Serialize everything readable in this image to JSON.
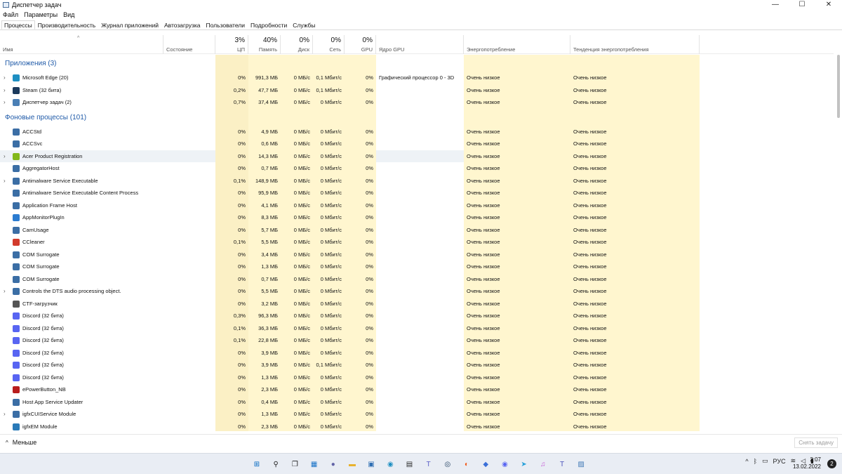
{
  "window": {
    "title": "Диспетчер задач",
    "controls": {
      "minimize": "—",
      "maximize": "☐",
      "close": "✕"
    }
  },
  "menu": [
    "Файл",
    "Параметры",
    "Вид"
  ],
  "tabs": [
    "Процессы",
    "Производительность",
    "Журнал приложений",
    "Автозагрузка",
    "Пользователи",
    "Подробности",
    "Службы"
  ],
  "active_tab": "Процессы",
  "columns": {
    "name": "Имя",
    "status": "Состояние",
    "cpu": {
      "pct": "3%",
      "label": "ЦП"
    },
    "memory": {
      "pct": "40%",
      "label": "Память"
    },
    "disk": {
      "pct": "0%",
      "label": "Диск"
    },
    "network": {
      "pct": "0%",
      "label": "Сеть"
    },
    "gpu": {
      "pct": "0%",
      "label": "GPU"
    },
    "gpu_engine": "Ядро GPU",
    "power": "Энергопотребление",
    "power_trend": "Тенденция энергопотребления"
  },
  "groups": {
    "apps": "Приложения (3)",
    "background": "Фоновые процессы (101)"
  },
  "apps": [
    {
      "name": "Microsoft Edge (20)",
      "expand": true,
      "icon": "edge-icon",
      "color": "#1e8fc2",
      "cpu": "0%",
      "mem": "991,3 МБ",
      "disk": "0 МБ/с",
      "net": "0,1 Мбит/с",
      "gpu": "0%",
      "engine": "Графический процессор 0 - 3D",
      "power": "Очень низкое",
      "trend": "Очень низкое"
    },
    {
      "name": "Steam (32 бита)",
      "expand": true,
      "icon": "steam-icon",
      "color": "#1b3a5c",
      "cpu": "0,2%",
      "mem": "47,7 МБ",
      "disk": "0 МБ/с",
      "net": "0,1 Мбит/с",
      "gpu": "0%",
      "engine": "",
      "power": "Очень низкое",
      "trend": "Очень низкое"
    },
    {
      "name": "Диспетчер задач (2)",
      "expand": true,
      "icon": "task-manager-icon",
      "color": "#4a7fb5",
      "cpu": "0,7%",
      "mem": "37,4 МБ",
      "disk": "0 МБ/с",
      "net": "0 Мбит/с",
      "gpu": "0%",
      "engine": "",
      "power": "Очень низкое",
      "trend": "Очень низкое"
    }
  ],
  "background": [
    {
      "name": "ACCStd",
      "expand": false,
      "icon": "window-icon",
      "color": "#3b6ea5",
      "cpu": "0%",
      "mem": "4,9 МБ",
      "disk": "0 МБ/с",
      "net": "0 Мбит/с",
      "gpu": "0%",
      "power": "Очень низкое",
      "trend": "Очень низкое"
    },
    {
      "name": "ACCSvc",
      "expand": false,
      "icon": "window-icon",
      "color": "#3b6ea5",
      "cpu": "0%",
      "mem": "0,6 МБ",
      "disk": "0 МБ/с",
      "net": "0 Мбит/с",
      "gpu": "0%",
      "power": "Очень низкое",
      "trend": "Очень низкое"
    },
    {
      "name": "Acer Product Registration",
      "expand": true,
      "icon": "acer-icon",
      "color": "#83b81a",
      "cpu": "0%",
      "mem": "14,3 МБ",
      "disk": "0 МБ/с",
      "net": "0 Мбит/с",
      "gpu": "0%",
      "power": "Очень низкое",
      "trend": "Очень низкое",
      "selected": true
    },
    {
      "name": "AggregatorHost",
      "expand": false,
      "icon": "window-icon",
      "color": "#3b6ea5",
      "cpu": "0%",
      "mem": "0,7 МБ",
      "disk": "0 МБ/с",
      "net": "0 Мбит/с",
      "gpu": "0%",
      "power": "Очень низкое",
      "trend": "Очень низкое"
    },
    {
      "name": "Antimalware Service Executable",
      "expand": true,
      "icon": "window-icon",
      "color": "#3b6ea5",
      "cpu": "0,1%",
      "mem": "148,9 МБ",
      "disk": "0 МБ/с",
      "net": "0 Мбит/с",
      "gpu": "0%",
      "power": "Очень низкое",
      "trend": "Очень низкое"
    },
    {
      "name": "Antimalware Service Executable Content Process",
      "expand": false,
      "icon": "window-icon",
      "color": "#3b6ea5",
      "cpu": "0%",
      "mem": "95,9 МБ",
      "disk": "0 МБ/с",
      "net": "0 Мбит/с",
      "gpu": "0%",
      "power": "Очень низкое",
      "trend": "Очень низкое"
    },
    {
      "name": "Application Frame Host",
      "expand": false,
      "icon": "window-icon",
      "color": "#3b6ea5",
      "cpu": "0%",
      "mem": "4,1 МБ",
      "disk": "0 МБ/с",
      "net": "0 Мбит/с",
      "gpu": "0%",
      "power": "Очень низкое",
      "trend": "Очень низкое"
    },
    {
      "name": "AppMonitorPlugIn",
      "expand": false,
      "icon": "app-monitor-icon",
      "color": "#2b7bd0",
      "cpu": "0%",
      "mem": "8,3 МБ",
      "disk": "0 МБ/с",
      "net": "0 Мбит/с",
      "gpu": "0%",
      "power": "Очень низкое",
      "trend": "Очень низкое"
    },
    {
      "name": "CamUsage",
      "expand": false,
      "icon": "window-icon",
      "color": "#3b6ea5",
      "cpu": "0%",
      "mem": "5,7 МБ",
      "disk": "0 МБ/с",
      "net": "0 Мбит/с",
      "gpu": "0%",
      "power": "Очень низкое",
      "trend": "Очень низкое"
    },
    {
      "name": "CCleaner",
      "expand": false,
      "icon": "ccleaner-icon",
      "color": "#d23b2c",
      "cpu": "0,1%",
      "mem": "5,5 МБ",
      "disk": "0 МБ/с",
      "net": "0 Мбит/с",
      "gpu": "0%",
      "power": "Очень низкое",
      "trend": "Очень низкое"
    },
    {
      "name": "COM Surrogate",
      "expand": false,
      "icon": "window-icon",
      "color": "#3b6ea5",
      "cpu": "0%",
      "mem": "3,4 МБ",
      "disk": "0 МБ/с",
      "net": "0 Мбит/с",
      "gpu": "0%",
      "power": "Очень низкое",
      "trend": "Очень низкое"
    },
    {
      "name": "COM Surrogate",
      "expand": false,
      "icon": "window-icon",
      "color": "#3b6ea5",
      "cpu": "0%",
      "mem": "1,3 МБ",
      "disk": "0 МБ/с",
      "net": "0 Мбит/с",
      "gpu": "0%",
      "power": "Очень низкое",
      "trend": "Очень низкое"
    },
    {
      "name": "COM Surrogate",
      "expand": false,
      "icon": "window-icon",
      "color": "#3b6ea5",
      "cpu": "0%",
      "mem": "0,7 МБ",
      "disk": "0 МБ/с",
      "net": "0 Мбит/с",
      "gpu": "0%",
      "power": "Очень низкое",
      "trend": "Очень низкое"
    },
    {
      "name": "Controls the DTS audio processing object.",
      "expand": true,
      "icon": "window-icon",
      "color": "#3b6ea5",
      "cpu": "0%",
      "mem": "5,5 МБ",
      "disk": "0 МБ/с",
      "net": "0 Мбит/с",
      "gpu": "0%",
      "power": "Очень низкое",
      "trend": "Очень низкое"
    },
    {
      "name": "CTF-загрузчик",
      "expand": false,
      "icon": "ctf-loader-icon",
      "color": "#555555",
      "cpu": "0%",
      "mem": "3,2 МБ",
      "disk": "0 МБ/с",
      "net": "0 Мбит/с",
      "gpu": "0%",
      "power": "Очень низкое",
      "trend": "Очень низкое"
    },
    {
      "name": "Discord (32 бита)",
      "expand": false,
      "icon": "discord-icon",
      "color": "#5865f2",
      "cpu": "0,3%",
      "mem": "96,3 МБ",
      "disk": "0 МБ/с",
      "net": "0 Мбит/с",
      "gpu": "0%",
      "power": "Очень низкое",
      "trend": "Очень низкое"
    },
    {
      "name": "Discord (32 бита)",
      "expand": false,
      "icon": "discord-icon",
      "color": "#5865f2",
      "cpu": "0,1%",
      "mem": "36,3 МБ",
      "disk": "0 МБ/с",
      "net": "0 Мбит/с",
      "gpu": "0%",
      "power": "Очень низкое",
      "trend": "Очень низкое"
    },
    {
      "name": "Discord (32 бита)",
      "expand": false,
      "icon": "discord-paused-icon",
      "color": "#5865f2",
      "cpu": "0,1%",
      "mem": "22,8 МБ",
      "disk": "0 МБ/с",
      "net": "0 Мбит/с",
      "gpu": "0%",
      "power": "Очень низкое",
      "trend": "Очень низкое"
    },
    {
      "name": "Discord (32 бита)",
      "expand": false,
      "icon": "discord-icon",
      "color": "#5865f2",
      "cpu": "0%",
      "mem": "3,9 МБ",
      "disk": "0 МБ/с",
      "net": "0 Мбит/с",
      "gpu": "0%",
      "power": "Очень низкое",
      "trend": "Очень низкое"
    },
    {
      "name": "Discord (32 бита)",
      "expand": false,
      "icon": "discord-icon",
      "color": "#5865f2",
      "cpu": "0%",
      "mem": "3,9 МБ",
      "disk": "0 МБ/с",
      "net": "0,1 Мбит/с",
      "gpu": "0%",
      "power": "Очень низкое",
      "trend": "Очень низкое"
    },
    {
      "name": "Discord (32 бита)",
      "expand": false,
      "icon": "discord-icon",
      "color": "#5865f2",
      "cpu": "0%",
      "mem": "1,3 МБ",
      "disk": "0 МБ/с",
      "net": "0 Мбит/с",
      "gpu": "0%",
      "power": "Очень низкое",
      "trend": "Очень низкое"
    },
    {
      "name": "ePowerButton_NB",
      "expand": false,
      "icon": "power-button-icon",
      "color": "#b81d1d",
      "cpu": "0%",
      "mem": "2,3 МБ",
      "disk": "0 МБ/с",
      "net": "0 Мбит/с",
      "gpu": "0%",
      "power": "Очень низкое",
      "trend": "Очень низкое"
    },
    {
      "name": "Host App Service Updater",
      "expand": false,
      "icon": "window-icon",
      "color": "#3b6ea5",
      "cpu": "0%",
      "mem": "0,4 МБ",
      "disk": "0 МБ/с",
      "net": "0 Мбит/с",
      "gpu": "0%",
      "power": "Очень низкое",
      "trend": "Очень низкое"
    },
    {
      "name": "igfxCUIService Module",
      "expand": true,
      "icon": "window-icon",
      "color": "#3b6ea5",
      "cpu": "0%",
      "mem": "1,3 МБ",
      "disk": "0 МБ/с",
      "net": "0 Мбит/с",
      "gpu": "0%",
      "power": "Очень низкое",
      "trend": "Очень низкое"
    },
    {
      "name": "igfxEM Module",
      "expand": false,
      "icon": "igfx-icon",
      "color": "#2a7ab8",
      "cpu": "0%",
      "mem": "2,3 МБ",
      "disk": "0 МБ/с",
      "net": "0 Мбит/с",
      "gpu": "0%",
      "power": "Очень низкое",
      "trend": "Очень низкое"
    }
  ],
  "footer": {
    "fewer_details": "Меньше",
    "end_task": "Снять задачу"
  },
  "taskbar": {
    "icons": [
      {
        "name": "start-icon",
        "glyph": "⊞",
        "color": "#0067c0"
      },
      {
        "name": "search-icon",
        "glyph": "⚲",
        "color": "#222222"
      },
      {
        "name": "task-view-icon",
        "glyph": "❐",
        "color": "#222222"
      },
      {
        "name": "widgets-icon",
        "glyph": "▦",
        "color": "#1a73c7"
      },
      {
        "name": "chat-icon",
        "glyph": "●",
        "color": "#6264a7"
      },
      {
        "name": "file-explorer-icon",
        "glyph": "▬",
        "color": "#e8b22e"
      },
      {
        "name": "store-icon",
        "glyph": "▣",
        "color": "#2f6fb3"
      },
      {
        "name": "edge-icon",
        "glyph": "◉",
        "color": "#1e8fc2"
      },
      {
        "name": "notepad-icon",
        "glyph": "▤",
        "color": "#2a2a2a"
      },
      {
        "name": "teams-icon",
        "glyph": "T",
        "color": "#5b5fc7"
      },
      {
        "name": "steam-icon",
        "glyph": "◎",
        "color": "#1b3a5c"
      },
      {
        "name": "origin-icon",
        "glyph": "◐",
        "color": "#f25b1b"
      },
      {
        "name": "vpn-icon",
        "glyph": "◆",
        "color": "#3a6fd8"
      },
      {
        "name": "discord-icon",
        "glyph": "◉",
        "color": "#5865f2"
      },
      {
        "name": "telegram-icon",
        "glyph": "➤",
        "color": "#2aa1da"
      },
      {
        "name": "itunes-icon",
        "glyph": "♫",
        "color": "#c55bd6"
      },
      {
        "name": "teams-work-icon",
        "glyph": "T",
        "color": "#4b53bc"
      },
      {
        "name": "task-manager-icon",
        "glyph": "▨",
        "color": "#3f78b5"
      }
    ],
    "tray": {
      "chevron": "^",
      "bluetooth": "ᛒ",
      "battery": "▭",
      "language": "РУС",
      "wifi": "≋",
      "volume": "◁",
      "battery2": "▮"
    },
    "time": "2:07",
    "date": "13.02.2022",
    "notifications": "2"
  },
  "colors": {
    "cpu_tint": "#fbf0c5",
    "col_tint": "#fff6cf",
    "selected_row": "#eef2f6",
    "group_title": "#1f5aa8"
  }
}
